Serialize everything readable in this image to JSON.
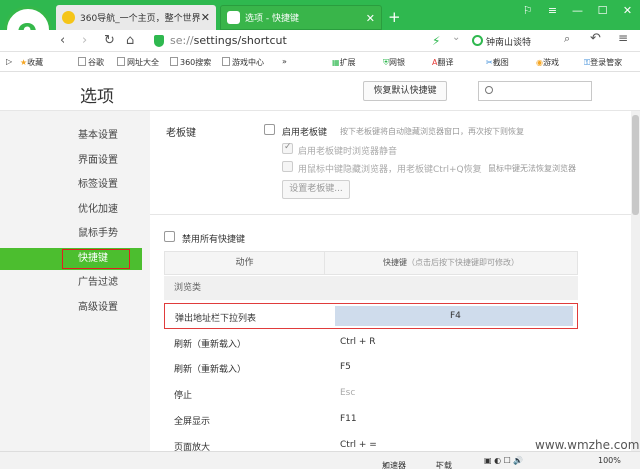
{
  "browser": {
    "tabs": [
      {
        "label": "360导航_一个主页，整个世界"
      },
      {
        "label": "选项 - 快捷键"
      }
    ],
    "new_tab": "+",
    "url_prefix": "se://",
    "url_path": "settings/shortcut",
    "search_text": "钟南山谈特",
    "zoom": "100%"
  },
  "bookmarks": [
    {
      "label": "收藏"
    },
    {
      "label": "谷歌"
    },
    {
      "label": "网址大全"
    },
    {
      "label": "360搜索"
    },
    {
      "label": "游戏中心"
    },
    {
      "label": "»"
    },
    {
      "label": "扩展"
    },
    {
      "label": "网银"
    },
    {
      "label": "翻译"
    },
    {
      "label": "截图"
    },
    {
      "label": "游戏"
    },
    {
      "label": "登录管家"
    }
  ],
  "page": {
    "title": "选项",
    "restore_button": "恢复默认快捷键",
    "search_placeholder": ""
  },
  "sidebar": {
    "items": [
      {
        "label": "基本设置"
      },
      {
        "label": "界面设置"
      },
      {
        "label": "标签设置"
      },
      {
        "label": "优化加速"
      },
      {
        "label": "鼠标手势"
      },
      {
        "label": "快捷键"
      },
      {
        "label": "广告过滤"
      },
      {
        "label": "高级设置"
      }
    ]
  },
  "boss_key": {
    "section_label": "老板键",
    "enable_label": "启用老板键",
    "enable_hint": "按下老板键将自动隐藏浏览器窗口，再次按下则恢复",
    "mute_label": "启用老板键时浏览器静音",
    "middle_label": "用鼠标中键隐藏浏览器，用老板键Ctrl+Q恢复",
    "middle_hint": "鼠标中键无法恢复浏览器",
    "set_button": "设置老板键..."
  },
  "shortcuts": {
    "disable_all_label": "禁用所有快捷键",
    "col_action": "动作",
    "col_key": "快捷键",
    "col_key_hint": "（点击后按下快捷键即可修改）",
    "group": "浏览类",
    "rows": [
      {
        "action": "弹出地址栏下拉列表",
        "key": "F4"
      },
      {
        "action": "刷新（重新载入）",
        "key": "Ctrl + R"
      },
      {
        "action": "刷新（重新载入）",
        "key": "F5"
      },
      {
        "action": "停止",
        "key": "Esc"
      },
      {
        "action": "全屏显示",
        "key": "F11"
      },
      {
        "action": "页面放大",
        "key": "Ctrl + ="
      }
    ]
  },
  "statusbar": {
    "accelerator": "加速器",
    "download": "下载",
    "zoom": "100%"
  },
  "watermark": "www.wmzhe.com"
}
